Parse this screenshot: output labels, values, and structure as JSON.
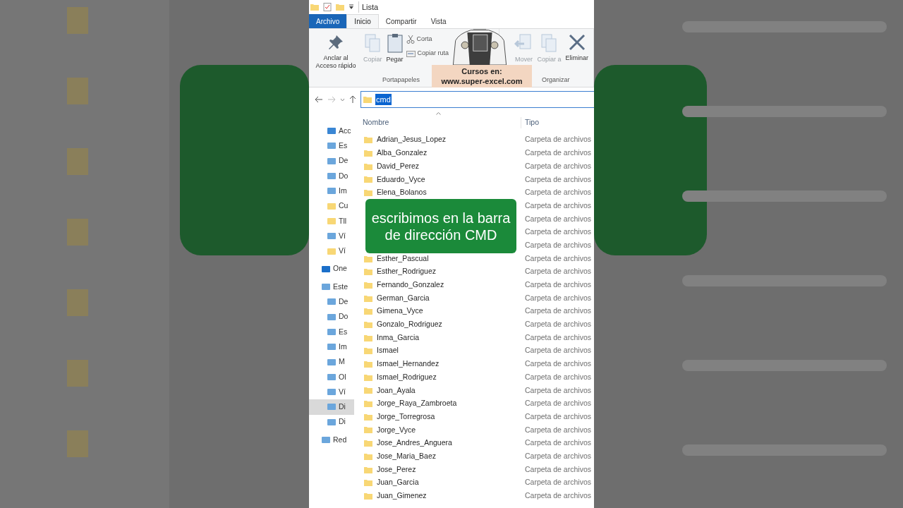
{
  "window": {
    "title": "Lista"
  },
  "tabs": [
    {
      "label": "Archivo",
      "kind": "file",
      "selected": false
    },
    {
      "label": "Inicio",
      "kind": "tab",
      "selected": true
    },
    {
      "label": "Compartir",
      "kind": "tab",
      "selected": false
    },
    {
      "label": "Vista",
      "kind": "tab",
      "selected": false
    }
  ],
  "ribbon": {
    "groups": [
      {
        "label": "Portapapeles",
        "buttons": [
          {
            "label": "Anclar al Acceso rápido",
            "kind": "large",
            "disabled": false
          },
          {
            "label": "Copiar",
            "kind": "large",
            "disabled": true
          },
          {
            "label": "Pegar",
            "kind": "large",
            "disabled": false
          },
          {
            "label": "Corta",
            "kind": "small",
            "disabled": false
          },
          {
            "label": "Copiar ruta",
            "kind": "small",
            "disabled": false
          }
        ]
      },
      {
        "label": "Organizar",
        "buttons": [
          {
            "label": "Mover",
            "kind": "large",
            "disabled": true
          },
          {
            "label": "Copiar a",
            "kind": "large",
            "disabled": true
          },
          {
            "label": "Eliminar",
            "kind": "large",
            "disabled": false
          }
        ]
      }
    ]
  },
  "promo": {
    "line1": "Cursos en:",
    "line2": "www.super-excel.com"
  },
  "address_bar": {
    "value": "cmd",
    "selected": true
  },
  "columns": [
    "Nombre",
    "Tipo"
  ],
  "sidebar": {
    "items": [
      {
        "label": "Acc",
        "selected": false
      },
      {
        "label": "Es",
        "selected": false
      },
      {
        "label": "De",
        "selected": false
      },
      {
        "label": "Do",
        "selected": false
      },
      {
        "label": "Im",
        "selected": false
      },
      {
        "label": "Cu",
        "selected": false
      },
      {
        "label": "Tll",
        "selected": false
      },
      {
        "label": "Ví",
        "selected": false
      },
      {
        "label": "Ví",
        "selected": false
      },
      {
        "label": "One",
        "selected": false
      },
      {
        "label": "Este",
        "selected": false
      },
      {
        "label": "De",
        "selected": false
      },
      {
        "label": "Do",
        "selected": false
      },
      {
        "label": "Es",
        "selected": false
      },
      {
        "label": "Im",
        "selected": false
      },
      {
        "label": "M",
        "selected": false
      },
      {
        "label": "Ol",
        "selected": false
      },
      {
        "label": "Ví",
        "selected": false
      },
      {
        "label": "Di",
        "selected": true
      },
      {
        "label": "Di",
        "selected": false
      },
      {
        "label": "Red",
        "selected": false
      }
    ]
  },
  "rows": [
    {
      "name": "Adrian_Jesus_Lopez",
      "type": "Carpeta de archivos"
    },
    {
      "name": "Alba_Gonzalez",
      "type": "Carpeta de archivos"
    },
    {
      "name": "David_Perez",
      "type": "Carpeta de archivos"
    },
    {
      "name": "Eduardo_Vyce",
      "type": "Carpeta de archivos"
    },
    {
      "name": "Elena_Bolanos",
      "type": "Carpeta de archivos"
    },
    {
      "type": "Carpeta de archivos"
    },
    {
      "type": "Carpeta de archivos"
    },
    {
      "type": "Carpeta de archivos"
    },
    {
      "type": "Carpeta de archivos"
    },
    {
      "name": "Esther_Pascual",
      "type": "Carpeta de archivos"
    },
    {
      "name": "Esther_Rodriguez",
      "type": "Carpeta de archivos"
    },
    {
      "name": "Fernando_Gonzalez",
      "type": "Carpeta de archivos"
    },
    {
      "name": "German_Garcia",
      "type": "Carpeta de archivos"
    },
    {
      "name": "Gimena_Vyce",
      "type": "Carpeta de archivos"
    },
    {
      "name": "Gonzalo_Rodriguez",
      "type": "Carpeta de archivos"
    },
    {
      "name": "Inma_Garcia",
      "type": "Carpeta de archivos"
    },
    {
      "name": "Ismael",
      "type": "Carpeta de archivos"
    },
    {
      "name": "Ismael_Hernandez",
      "type": "Carpeta de archivos"
    },
    {
      "name": "Ismael_Rodriguez",
      "type": "Carpeta de archivos"
    },
    {
      "name": "Joan_Ayala",
      "type": "Carpeta de archivos"
    },
    {
      "name": "Jorge_Raya_Zambroeta",
      "type": "Carpeta de archivos"
    },
    {
      "name": "Jorge_Torregrosa",
      "type": "Carpeta de archivos"
    },
    {
      "name": "Jorge_Vyce",
      "type": "Carpeta de archivos"
    },
    {
      "name": "Jose_Andres_Anguera",
      "type": "Carpeta de archivos"
    },
    {
      "name": "Jose_Maria_Baez",
      "type": "Carpeta de archivos"
    },
    {
      "name": "Jose_Perez",
      "type": "Carpeta de archivos"
    },
    {
      "name": "Juan_Garcia",
      "type": "Carpeta de archivos"
    },
    {
      "name": "Juan_Gimenez",
      "type": "Carpeta de archivos"
    }
  ],
  "caption": "escribimos en la barra de dirección CMD"
}
